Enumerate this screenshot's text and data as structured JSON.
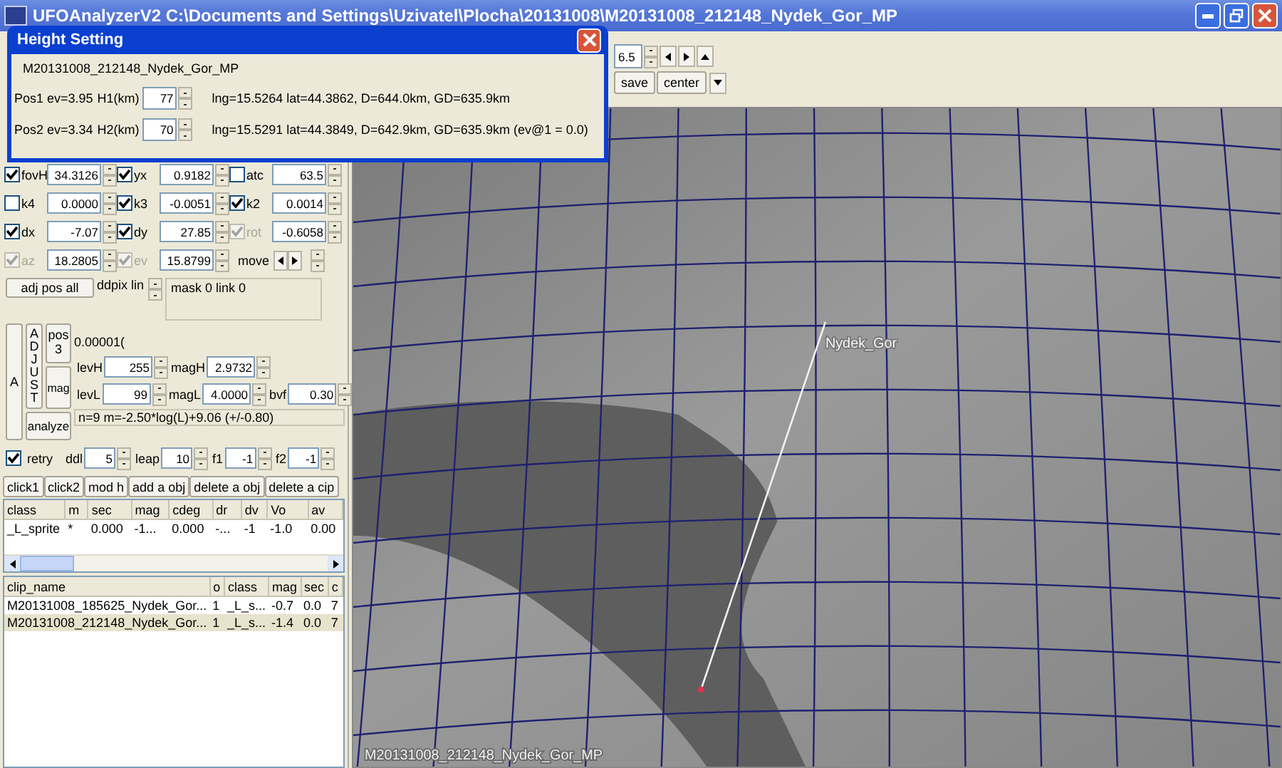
{
  "window": {
    "title": "UFOAnalyzerV2 C:\\Documents and Settings\\Uzivatel\\Plocha\\20131008\\M20131008_212148_Nydek_Gor_MP"
  },
  "dialog": {
    "title": "Height Setting",
    "clip": "M20131008_212148_Nydek_Gor_MP",
    "positions": [
      {
        "label": "Pos1 ev=3.95",
        "field_label": "H1(km)",
        "value": "77",
        "info": "lng=15.5264 lat=44.3862, D=644.0km, GD=635.9km"
      },
      {
        "label": "Pos2 ev=3.34",
        "field_label": "H2(km)",
        "value": "70",
        "info": "lng=15.5291 lat=44.3849, D=642.9km, GD=635.9km  (ev@1 = 0.0)"
      }
    ]
  },
  "params": [
    {
      "label": "fovH",
      "checked": true,
      "disabled": false,
      "value": "34.3126"
    },
    {
      "label": "yx",
      "checked": true,
      "disabled": false,
      "value": "0.9182"
    },
    {
      "label": "atc",
      "checked": false,
      "disabled": false,
      "value": "63.5"
    },
    {
      "label": "k4",
      "checked": false,
      "disabled": false,
      "value": "0.0000"
    },
    {
      "label": "k3",
      "checked": true,
      "disabled": false,
      "value": "-0.0051"
    },
    {
      "label": "k2",
      "checked": true,
      "disabled": false,
      "value": "0.0014"
    },
    {
      "label": "dx",
      "checked": true,
      "disabled": false,
      "value": "-7.07"
    },
    {
      "label": "dy",
      "checked": true,
      "disabled": false,
      "value": "27.85"
    },
    {
      "label": "rot",
      "checked": true,
      "disabled": true,
      "value": "-0.6058"
    },
    {
      "label": "az",
      "checked": true,
      "disabled": true,
      "value": "18.2805"
    },
    {
      "label": "ev",
      "checked": true,
      "disabled": true,
      "value": "15.8799"
    }
  ],
  "move": {
    "label": "move"
  },
  "adjust": {
    "adj_pos_all": "adj pos all",
    "ddpix_label": "ddpix lin",
    "mask": "mask 0  link 0",
    "a_button": "A",
    "adjust_button": "ADJUST",
    "pos_button": "pos 3",
    "value": "0.00001(",
    "mag_button": "mag",
    "analyze_button": "analyze",
    "fields": [
      {
        "label": "levH",
        "value": "255"
      },
      {
        "label": "magH",
        "value": "2.9732"
      },
      {
        "label": "levL",
        "value": "99"
      },
      {
        "label": "magL",
        "value": "4.0000"
      },
      {
        "label": "bvf",
        "value": "0.30"
      }
    ],
    "formula": "n=9 m=-2.50*log(L)+9.06 (+/-0.80)"
  },
  "retry": {
    "label": "retry",
    "checked": true,
    "fields": [
      {
        "label": "ddl",
        "value": "5"
      },
      {
        "label": "leap",
        "value": "10"
      },
      {
        "label": "f1",
        "value": "-1"
      },
      {
        "label": "f2",
        "value": "-1"
      }
    ]
  },
  "actions": [
    "click1",
    "click2",
    "mod h",
    "add a obj",
    "delete a obj",
    "delete a cip"
  ],
  "objects_table": {
    "columns": [
      "class",
      "m",
      "sec",
      "mag",
      "cdeg",
      "dr",
      "dv",
      "Vo",
      "av"
    ],
    "rows": [
      {
        "selected": false,
        "cells": [
          "_L_sprite",
          "*",
          "0.000",
          "-1...",
          "0.000",
          "-...",
          "-1",
          "-1.0",
          "0.00"
        ]
      }
    ]
  },
  "clips_table": {
    "columns": [
      "clip_name",
      "o",
      "class",
      "mag",
      "sec",
      "c"
    ],
    "rows": [
      {
        "selected": false,
        "cells": [
          "M20131008_185625_Nydek_Gor...",
          "1",
          "_L_s...",
          "-0.7",
          "0.0",
          "7"
        ]
      },
      {
        "selected": true,
        "cells": [
          "M20131008_212148_Nydek_Gor...",
          "1",
          "_L_s...",
          "-1.4",
          "0.0",
          "7"
        ]
      }
    ]
  },
  "toolbar": {
    "zoom": "6.5",
    "save": "save",
    "center": "center"
  },
  "map": {
    "station_label": "Nydek_Gor",
    "caption": "M20131008_212148_Nydek_Gor_MP"
  }
}
